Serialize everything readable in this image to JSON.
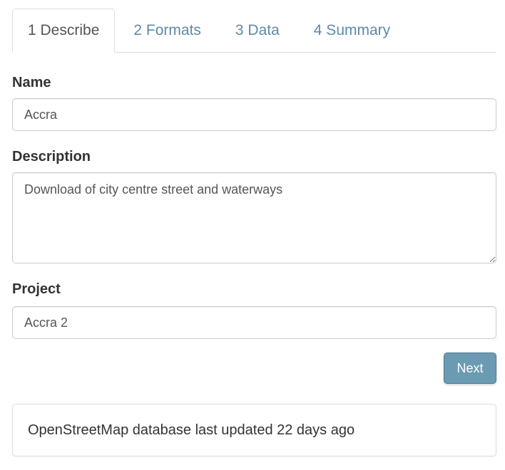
{
  "tabs": [
    {
      "label": "1 Describe",
      "active": true
    },
    {
      "label": "2 Formats",
      "active": false
    },
    {
      "label": "3 Data",
      "active": false
    },
    {
      "label": "4 Summary",
      "active": false
    }
  ],
  "form": {
    "name": {
      "label": "Name",
      "value": "Accra"
    },
    "description": {
      "label": "Description",
      "value": "Download of city centre street and waterways"
    },
    "project": {
      "label": "Project",
      "value": "Accra 2"
    },
    "next_label": "Next"
  },
  "status": {
    "text": "OpenStreetMap database last updated 22 days ago"
  },
  "colors": {
    "link": "#5d8aa8",
    "button": "#6b9bb3"
  }
}
